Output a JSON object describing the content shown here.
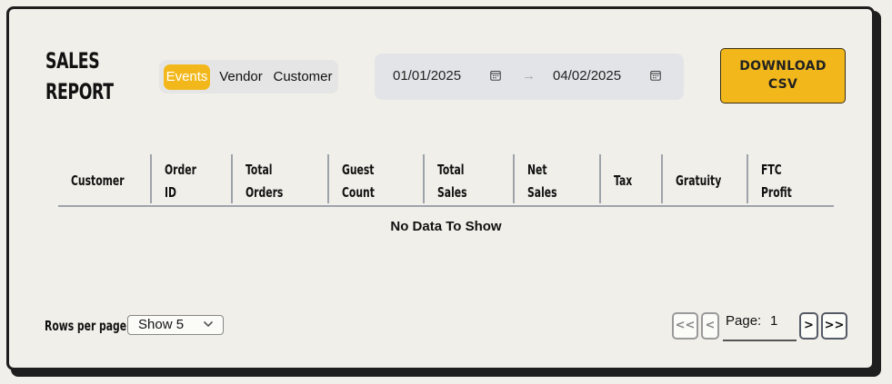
{
  "header": {
    "title_line1": "SALES",
    "title_line2": "REPORT",
    "download_line1": "DOWNLOAD",
    "download_line2": "CSV"
  },
  "tabs": [
    {
      "label": "Events",
      "active": true
    },
    {
      "label": "Vendor",
      "active": false
    },
    {
      "label": "Customer",
      "active": false
    }
  ],
  "date_range": {
    "start": "01/01/2025",
    "separator": "→",
    "end": "04/02/2025"
  },
  "table": {
    "columns": [
      {
        "line1": "Customer",
        "line2": ""
      },
      {
        "line1": "Order",
        "line2": "ID"
      },
      {
        "line1": "Total",
        "line2": "Orders"
      },
      {
        "line1": "Guest",
        "line2": "Count"
      },
      {
        "line1": "Total",
        "line2": "Sales"
      },
      {
        "line1": "Net",
        "line2": "Sales"
      },
      {
        "line1": "Tax",
        "line2": ""
      },
      {
        "line1": "Gratuity",
        "line2": ""
      },
      {
        "line1": "FTC",
        "line2": "Profit"
      }
    ],
    "empty_message": "No Data To Show"
  },
  "footer": {
    "rows_per_page_label": "Rows per page:",
    "rows_per_page_value": "Show 5",
    "first_label": "<<",
    "prev_label": "<",
    "page_label": "Page:",
    "page_number": "1",
    "next_label": ">",
    "last_label": ">>"
  },
  "colors": {
    "accent": "#f2b81b",
    "background": "#f0efe9",
    "border": "#1e1e1e"
  }
}
